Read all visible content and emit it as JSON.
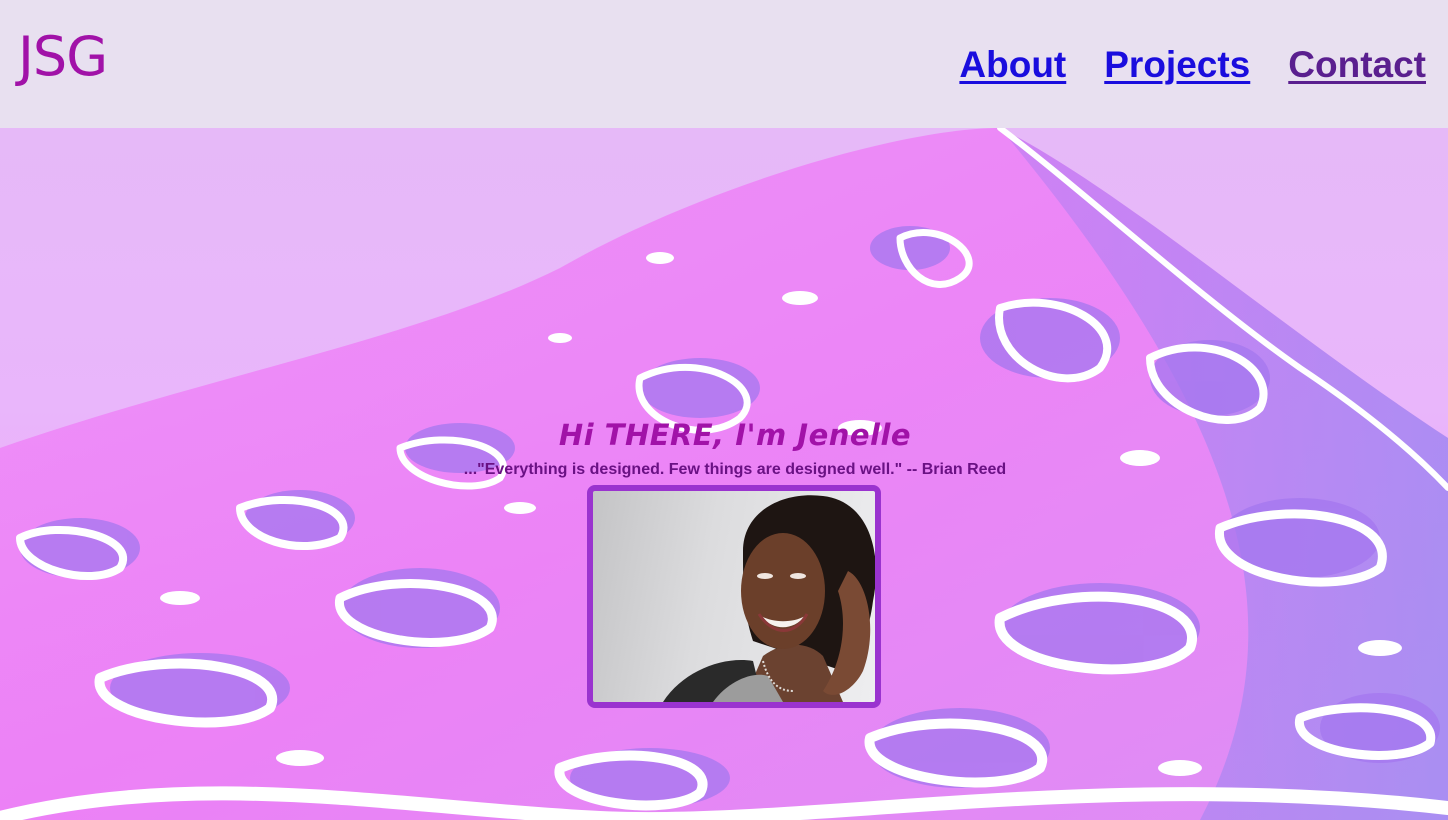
{
  "header": {
    "logo": "JSG",
    "nav": [
      {
        "label": "About",
        "state": "unvisited"
      },
      {
        "label": "Projects",
        "state": "unvisited"
      },
      {
        "label": "Contact",
        "state": "visited"
      }
    ]
  },
  "hero": {
    "greeting": "Hi THERE, I'm Jenelle",
    "quote": "...\"Everything is designed. Few things are designed well.\" -- Brian Reed",
    "portrait_icon": "portrait-photo"
  },
  "colors": {
    "header_bg": "#e8e0f0",
    "brand": "#a112a8",
    "link": "#1a0dde",
    "link_visited": "#5a1f8f",
    "frame": "#9a33cf"
  }
}
